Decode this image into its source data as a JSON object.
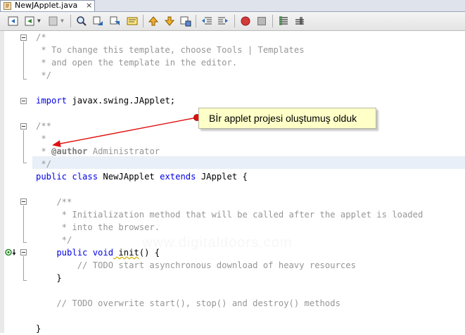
{
  "tab": {
    "title": "NewJApplet.java",
    "close": "×"
  },
  "toolbar": {
    "buttons": [
      "back-icon",
      "history-icon",
      "bookmark-icon",
      "find-icon",
      "find-previous-icon",
      "find-next-icon",
      "toggle-highlight-icon",
      "previous-bookmark-icon",
      "next-bookmark-icon",
      "toggle-bookmark-icon",
      "shift-left-icon",
      "shift-right-icon",
      "record-macro-icon",
      "stop-macro-icon",
      "comment-icon",
      "uncomment-icon"
    ]
  },
  "code": {
    "l1": "/*",
    "l2": " * To change this template, choose Tools | Templates",
    "l3": " * and open the template in the editor.",
    "l4": " */",
    "l6_kw": "import",
    "l6_rest": " javax.swing.JApplet;",
    "l8": "/**",
    "l9": " *",
    "l10_pre": " * ",
    "l10_tag": "@author",
    "l10_rest": " Administrator",
    "l11": " */",
    "l12_kw1": "public class",
    "l12_name": " NewJApplet ",
    "l12_kw2": "extends",
    "l12_rest": " JApplet {",
    "l14": "    /**",
    "l15": "     * Initialization method that will be called after the applet is loaded",
    "l16": "     * into the browser.",
    "l17": "     */",
    "l18_kw": "    public void",
    "l18_name": " init",
    "l18_rest": "() {",
    "l19": "        // TODO start asynchronous download of heavy resources",
    "l20": "    }",
    "l22": "    // TODO overwrite start(), stop() and destroy() methods",
    "l24": "}"
  },
  "callout": {
    "text": "Bİr applet projesi oluştumuş olduk"
  },
  "watermark": "www.digitaldoors.com"
}
